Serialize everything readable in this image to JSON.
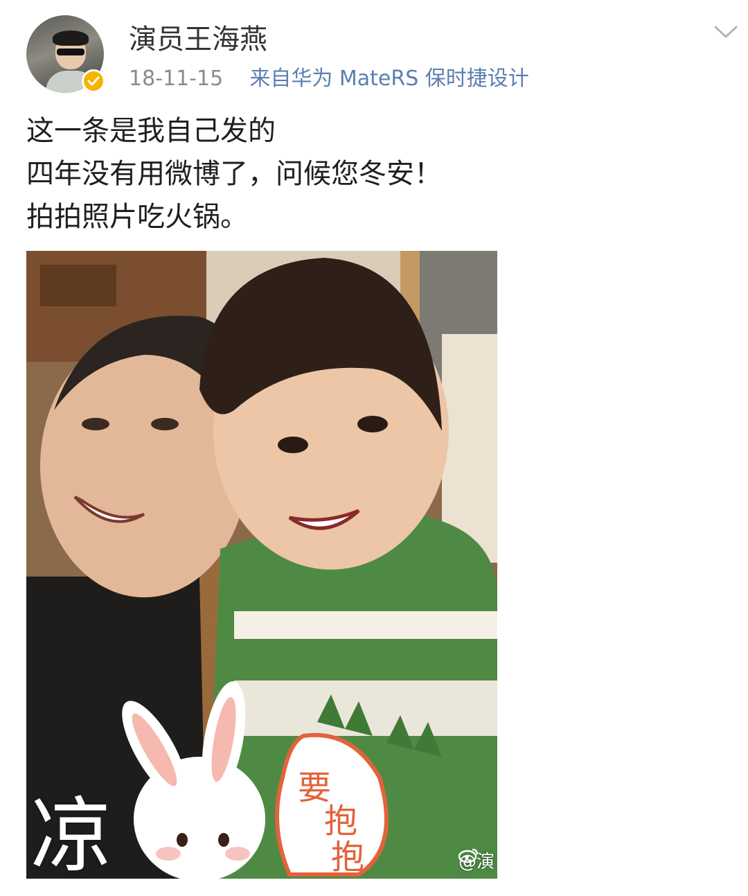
{
  "post": {
    "author": "演员王海燕",
    "date": "18-11-15",
    "source": "来自华为 MateRS 保时捷设计",
    "verified": true,
    "text_lines": [
      "这一条是我自己发的",
      "四年没有用微博了，问候您冬安！",
      "拍拍照片吃火锅。"
    ],
    "image": {
      "sticker_left": "凉",
      "sticker_bubble": [
        "要",
        "抱",
        "抱"
      ],
      "watermark": "@演"
    }
  },
  "icons": {
    "avatar": "avatar-photo",
    "badge": "verified-badge-icon",
    "chevron": "chevron-down-icon",
    "weibo": "weibo-logo-icon"
  },
  "colors": {
    "badge": "#f5b400",
    "source_link": "#5a7fb0",
    "meta_gray": "#8a8a8a"
  }
}
